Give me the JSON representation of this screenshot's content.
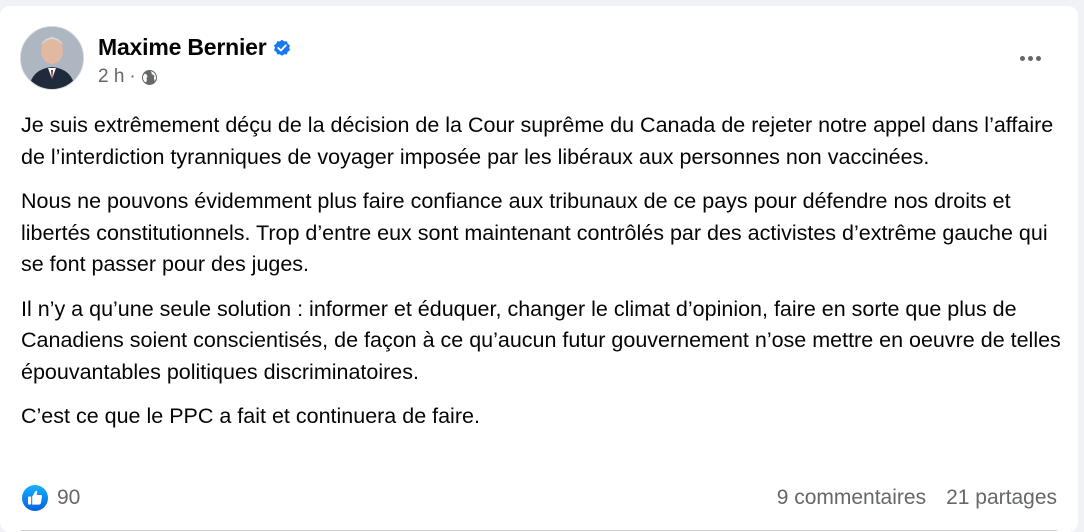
{
  "post": {
    "author": "Maxime Bernier",
    "time": "2 h",
    "separator": "·",
    "paragraphs": [
      "Je suis extrêmement déçu de la décision de la Cour suprême du Canada de rejeter notre appel dans l’affaire de l’interdiction tyranniques de voyager imposée par les libéraux aux personnes non vaccinées.",
      "Nous ne pouvons évidemment plus faire confiance aux tribunaux de ce pays pour défendre nos droits et libertés constitutionnels. Trop d’entre eux sont maintenant contrôlés par des activistes d’extrême gauche qui se font passer pour des juges.",
      "Il n’y a qu’une seule solution : informer et éduquer, changer le climat d’opinion, faire en sorte que plus de Canadiens soient conscientisés, de façon à ce qu’aucun futur gouvernement n’ose mettre en oeuvre de telles épouvantables politiques discriminatoires.",
      "C’est ce que le PPC a fait et continuera de faire."
    ],
    "reactions_count": "90",
    "comments": "9 commentaires",
    "shares": "21 partages"
  },
  "icons": {
    "verified": "verified-badge-icon",
    "privacy": "globe-icon",
    "more": "more-dots-icon",
    "like": "like-icon"
  },
  "colors": {
    "accent": "#1877f2",
    "secondary_text": "#65676b",
    "background": "#f0f2f5"
  }
}
